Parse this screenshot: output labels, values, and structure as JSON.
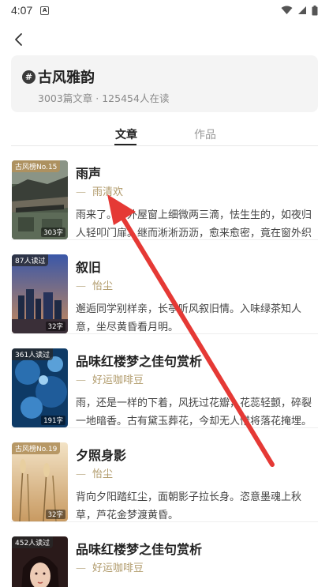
{
  "status_bar": {
    "time": "4:07",
    "notif_letter": "A",
    "wifi_icon": "wifi-icon",
    "signal_icon": "signal-icon",
    "battery_icon": "battery-icon"
  },
  "header": {
    "back_icon": "chevron-left-icon"
  },
  "topic": {
    "title": "古风雅韵",
    "meta": "3003篇文章 · 125454人在读"
  },
  "tabs": [
    {
      "label": "文章",
      "active": true
    },
    {
      "label": "作品",
      "active": false
    }
  ],
  "articles": [
    {
      "badge": "古风榜No.15",
      "badge_style": "gold",
      "count": "303字",
      "title": "雨声",
      "author": "雨清欢",
      "excerpt": "雨来了。窗外屋窗上细微两三滴，怯生生的，如夜归人轻叩门扉。继而淅淅沥沥，愈来愈密，竟在窗外织就..."
    },
    {
      "badge": "87人读过",
      "badge_style": "dark",
      "count": "32字",
      "title": "叙旧",
      "author": "怡尘",
      "excerpt": "邂逅同学别样亲，长亭听风叙旧情。入味绿茶知人意，坐尽黄昏看月明。"
    },
    {
      "badge": "361人读过",
      "badge_style": "dark",
      "count": "191字",
      "title": "品味红楼梦之佳句赏析",
      "author": "好运咖啡豆",
      "excerpt": "雨，还是一样的下着，风抚过花瓣，花蕊轻颤，碎裂一地暗香。古有黛玉葬花，今却无人惜将落花掩埋。"
    },
    {
      "badge": "古风榜No.19",
      "badge_style": "gold",
      "count": "32字",
      "title": "夕照身影",
      "author": "怡尘",
      "excerpt": "背向夕阳踏红尘，面朝影子拉长身。恣意墨魂上秋草，芦花金梦渡黄昏。"
    },
    {
      "badge": "452人读过",
      "badge_style": "dark",
      "count": "",
      "title": "品味红楼梦之佳句赏析",
      "author": "好运咖啡豆",
      "excerpt": ""
    }
  ],
  "colors": {
    "accent_author": "#b09a6a",
    "annotation_arrow": "#e53935"
  }
}
